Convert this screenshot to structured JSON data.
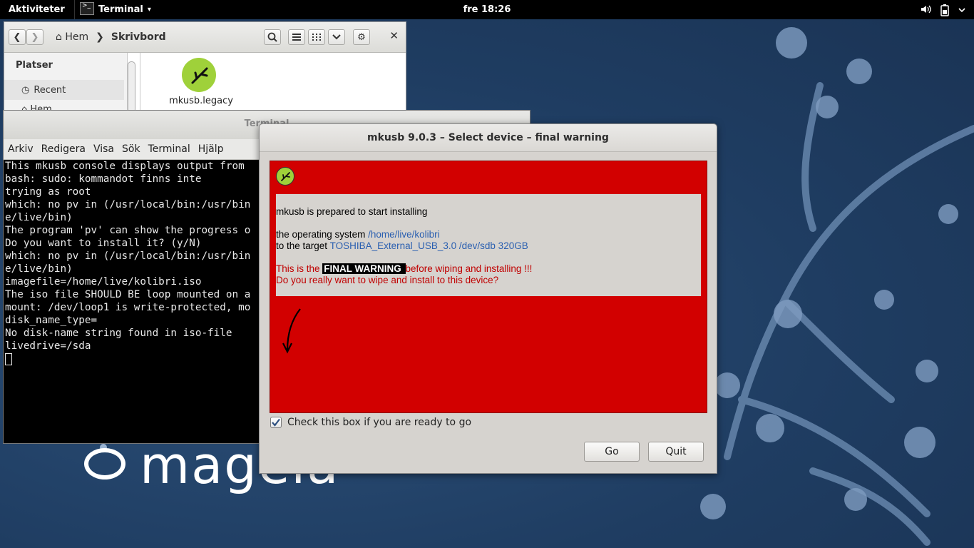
{
  "topbar": {
    "activities": "Aktiviteter",
    "app_name": "Terminal",
    "app_menu_arrow": "▾",
    "clock": "fre 18:26",
    "tray_icons": [
      "volume-icon",
      "battery-icon",
      "system-menu-icon"
    ]
  },
  "files": {
    "breadcrumb_home": "Hem",
    "breadcrumb_current": "Skrivbord",
    "sidebar_header": "Platser",
    "sidebar_items": [
      "Recent",
      "Hem"
    ],
    "file_label": "mkusb.legacy"
  },
  "terminal": {
    "title": "Terminal",
    "menu": [
      "Arkiv",
      "Redigera",
      "Visa",
      "Sök",
      "Terminal",
      "Hjälp"
    ],
    "lines": [
      "This mkusb console displays output from",
      "bash: sudo: kommandot finns inte",
      "trying as root",
      "which: no pv in (/usr/local/bin:/usr/bin",
      "e/live/bin)",
      "The program 'pv' can show the progress o",
      "Do you want to install it? (y/N)",
      "which: no pv in (/usr/local/bin:/usr/bin",
      "e/live/bin)",
      "imagefile=/home/live/kolibri.iso",
      "The iso file SHOULD BE loop mounted on a",
      "mount: /dev/loop1 is write-protected, mo",
      "disk_name_type=",
      "No disk-name string found in iso-file",
      "livedrive=/sda"
    ]
  },
  "desktop": {
    "logo_text": "mageia"
  },
  "dialog": {
    "title": "mkusb 9.0.3 – Select device – final warning",
    "line1": "mkusb is prepared to start installing",
    "os_prefix": "the operating system ",
    "os_value": "/home/live/kolibri",
    "target_prefix": "to the target ",
    "target_value": "TOSHIBA_External_USB_3.0 /dev/sdb 320GB",
    "warn_prefix": "This is the ",
    "warn_highlight": "FINAL WARNING ",
    "warn_suffix": "before wiping and installing !!!",
    "question": "Do you really want to wipe and install to this device?",
    "checkbox_label": "Check this box if you are ready to go",
    "checkbox_checked": true,
    "go_label": "Go",
    "quit_label": "Quit",
    "colors": {
      "warning_red": "#d20000",
      "link_blue": "#2a5fb0"
    }
  }
}
